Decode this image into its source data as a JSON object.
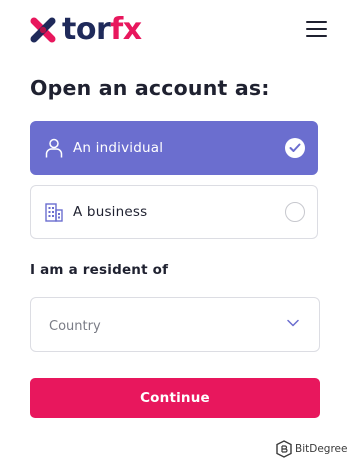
{
  "header": {
    "logo_text_tor": "tor",
    "logo_text_fx": "fx",
    "logo_icon": "torfx-x-logo",
    "menu_icon": "hamburger-menu-icon"
  },
  "form": {
    "title": "Open an account as:",
    "options": [
      {
        "label": "An individual",
        "icon": "person-icon",
        "selected": true
      },
      {
        "label": "A business",
        "icon": "building-icon",
        "selected": false
      }
    ],
    "resident_label": "I am a resident of",
    "country_placeholder": "Country",
    "continue_label": "Continue"
  },
  "watermark": {
    "text": "BitDegree"
  },
  "colors": {
    "brand_pink": "#e8175d",
    "brand_navy": "#1f2a5a",
    "selected_option": "#6b6ecf",
    "border": "#dcdde3"
  }
}
